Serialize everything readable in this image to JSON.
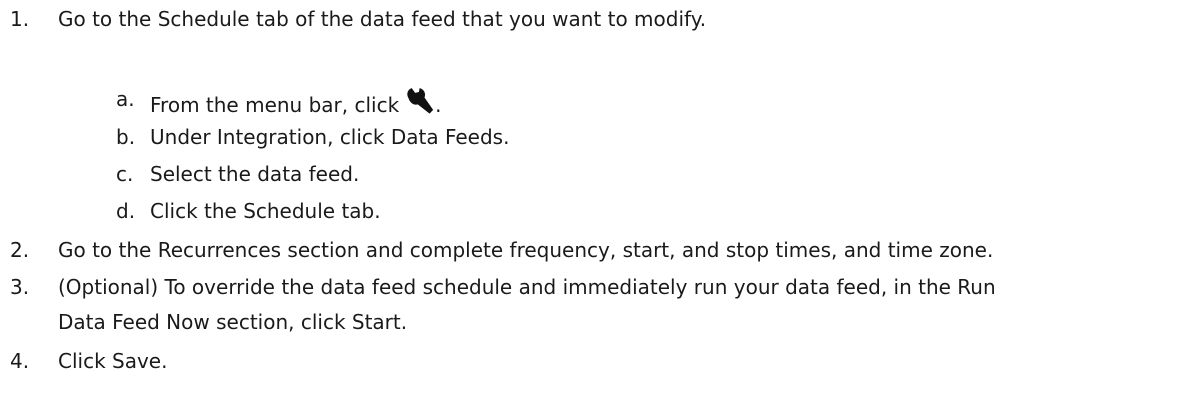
{
  "steps": [
    {
      "num": "1.",
      "text": "Go to the Schedule tab of the data feed that you want to modify."
    },
    {
      "num": "2.",
      "text": "Go to the Recurrences section and complete frequency, start, and stop times, and time zone."
    },
    {
      "num": "3.",
      "text": "(Optional) To override the data feed schedule and immediately run your data feed, in the Run",
      "text_cont": "Data Feed Now section, click Start."
    },
    {
      "num": "4.",
      "text": "Click Save."
    }
  ],
  "substeps": [
    {
      "letter": "a.",
      "text": "From the menu bar, click",
      "after_icon": ".",
      "icon": "wrench-icon"
    },
    {
      "letter": "b.",
      "text": "Under Integration, click Data Feeds."
    },
    {
      "letter": "c.",
      "text": "Select the data feed."
    },
    {
      "letter": "d.",
      "text": "Click the Schedule tab."
    }
  ]
}
